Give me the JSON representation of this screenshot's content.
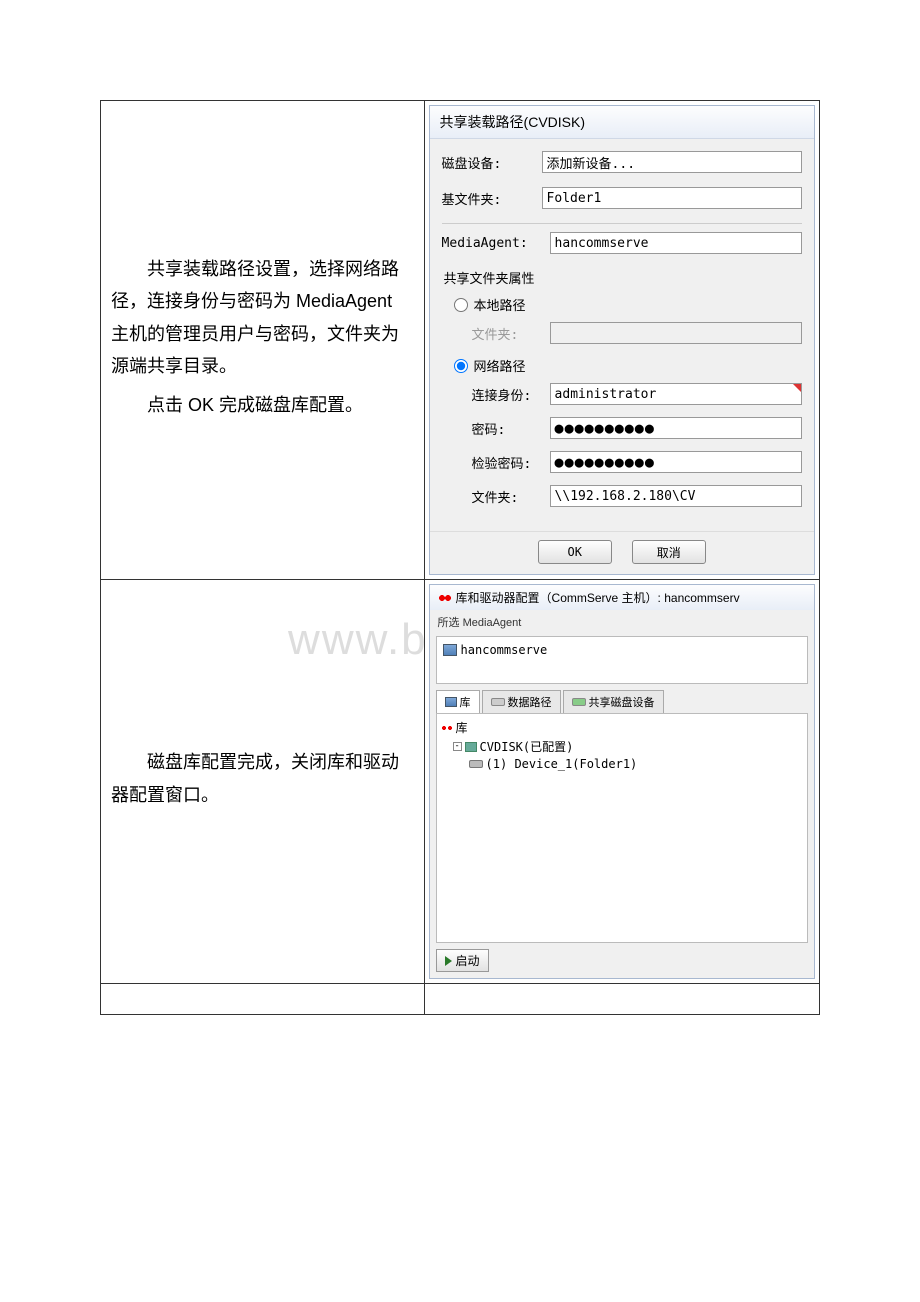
{
  "row1": {
    "desc": {
      "p1": "共享装载路径设置，选择网络路径，连接身份与密码为 MediaAgent 主机的管理员用户与密码，文件夹为源端共享目录。",
      "p2": "点击 OK 完成磁盘库配置。"
    },
    "dialog": {
      "title": "共享装载路径(CVDISK)",
      "disk_label": "磁盘设备:",
      "disk_value": "添加新设备...",
      "base_label": "基文件夹:",
      "base_value": "Folder1",
      "ma_label": "MediaAgent:",
      "ma_value": "hancommserve",
      "fs_title": "共享文件夹属性",
      "radio_local": "本地路径",
      "local_folder_label": "文件夹:",
      "radio_net": "网络路径",
      "conn_label": "连接身份:",
      "conn_value": "administrator",
      "pwd_label": "密码:",
      "pwd_value": "●●●●●●●●●●",
      "vpwd_label": "检验密码:",
      "vpwd_value": "●●●●●●●●●●",
      "folder_label": "文件夹:",
      "folder_value": "\\\\192.168.2.180\\CV",
      "ok": "OK",
      "cancel": "取消"
    }
  },
  "row2": {
    "desc": "磁盘库配置完成，关闭库和驱动器配置窗口。",
    "dialog": {
      "title": "库和驱动器配置（CommServe 主机）: hancommserv",
      "sel_label": "所选 MediaAgent",
      "sel_value": "hancommserve",
      "tab1": "库",
      "tab2": "数据路径",
      "tab3": "共享磁盘设备",
      "tree_root": "库",
      "tree_lib": "CVDISK(已配置)",
      "tree_dev": "(1) Device_1(Folder1)",
      "start_btn": "启动"
    }
  }
}
